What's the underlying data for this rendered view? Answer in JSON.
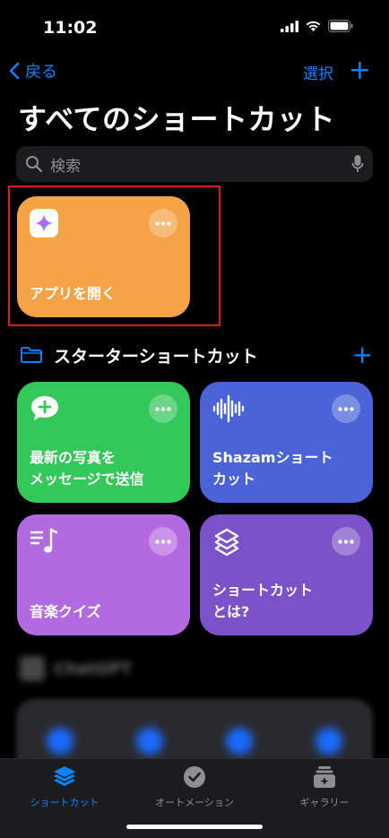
{
  "status": {
    "time": "11:02"
  },
  "nav": {
    "back_label": "戻る",
    "select_label": "選択",
    "add_label": "+"
  },
  "page": {
    "title": "すべてのショートカット"
  },
  "search": {
    "placeholder": "検索"
  },
  "shortcuts": [
    {
      "label": "アプリを開く",
      "color": "#f5a347",
      "icon": "sparkle-app-icon"
    }
  ],
  "section": {
    "title": "スターターショートカット",
    "add_label": "+"
  },
  "starter": [
    {
      "label": "最新の写真を\nメッセージで送信",
      "color": "#34c759",
      "icon": "message-plus-icon"
    },
    {
      "label": "Shazamショート\nカット",
      "color": "#4a63d6",
      "icon": "waveform-icon"
    },
    {
      "label": "音楽クイズ",
      "color": "#b36ae0",
      "icon": "music-list-icon"
    },
    {
      "label": "ショートカット\nとは?",
      "color": "#7c52c8",
      "icon": "shortcuts-layers-icon"
    }
  ],
  "blurred": {
    "label": "ChatGPT"
  },
  "tabs": [
    {
      "label": "ショートカット",
      "active": true,
      "icon": "shortcuts-stack-icon"
    },
    {
      "label": "オートメーション",
      "active": false,
      "icon": "clock-check-icon"
    },
    {
      "label": "ギャラリー",
      "active": false,
      "icon": "gallery-icon"
    }
  ],
  "colors": {
    "accent": "#0a84ff",
    "highlight": "#e01818"
  }
}
